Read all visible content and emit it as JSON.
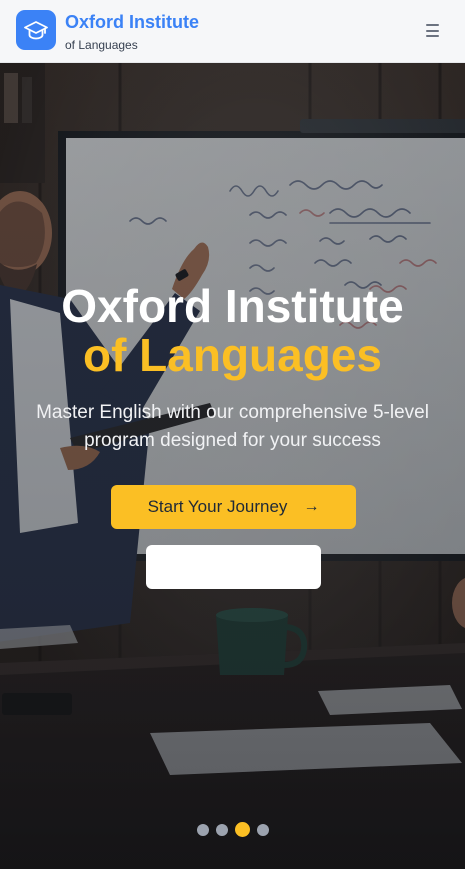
{
  "header": {
    "brand_title": "Oxford Institute",
    "brand_subtitle": "of Languages",
    "logo_icon": "graduation-cap-icon",
    "menu_icon": "hamburger-menu-icon",
    "background_color": "#f6f7f9",
    "accent_color": "#3b82f6"
  },
  "whiteboard": {
    "lines": [
      "Client Guidance Pronunciation",
      "Words th  Bareford  The  Consultation",
      "Roses  Z  Q+  Link  NO-Z",
      "Z  Example  Powderbas",
      "Zin  Bond  Pastoral",
      "Answer  Quiet"
    ]
  },
  "hero": {
    "title_line1": "Oxford Institute",
    "title_line2": "of Languages",
    "description": "Master English with our comprehensive 5-level program designed for your success",
    "cta_label": "Start Your Journey",
    "cta_icon": "arrow-right-icon",
    "secondary_label": "",
    "title_color": "#ffffff",
    "highlight_color": "#fbbf24",
    "button_color": "#fbbf24"
  },
  "carousel": {
    "slide_count": 4,
    "active_index": 2
  }
}
